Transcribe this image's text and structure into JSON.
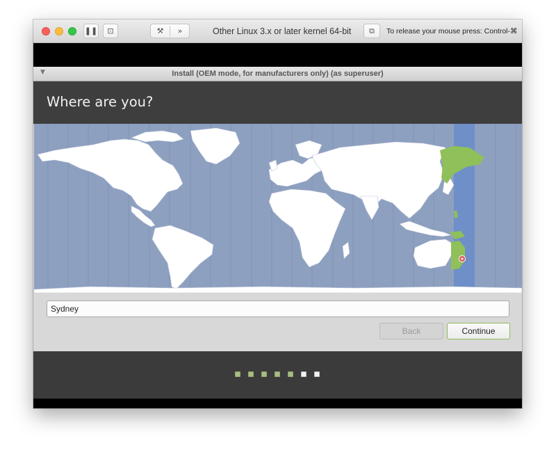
{
  "vm_toolbar": {
    "title": "Other Linux 3.x or later kernel 64-bit",
    "release_hint": "To release your mouse press: Control-⌘",
    "pause_icon": "pause-icon",
    "snapshot_icon": "snapshot-icon",
    "settings_icon": "wrench-icon",
    "more_icon": "chevron-double-right-icon",
    "fullscreen_icon": "window-icon"
  },
  "installer": {
    "window_title": "Install (OEM mode, for manufacturers only) (as superuser)",
    "menu_glyph": "▼",
    "heading": "Where are you?",
    "location_value": "Sydney",
    "back_label": "Back",
    "continue_label": "Continue"
  },
  "map": {
    "ocean_color": "#8ea0c0",
    "selected_zone_color": "#6e8fc8",
    "highlight_color": "#8fc05a",
    "land_color": "#ffffff",
    "pin_color": "#e0524d"
  },
  "progress": {
    "total_steps": 7,
    "completed_steps": 5,
    "done_color": "#a6bd85",
    "todo_color": "#f3f3f3"
  }
}
